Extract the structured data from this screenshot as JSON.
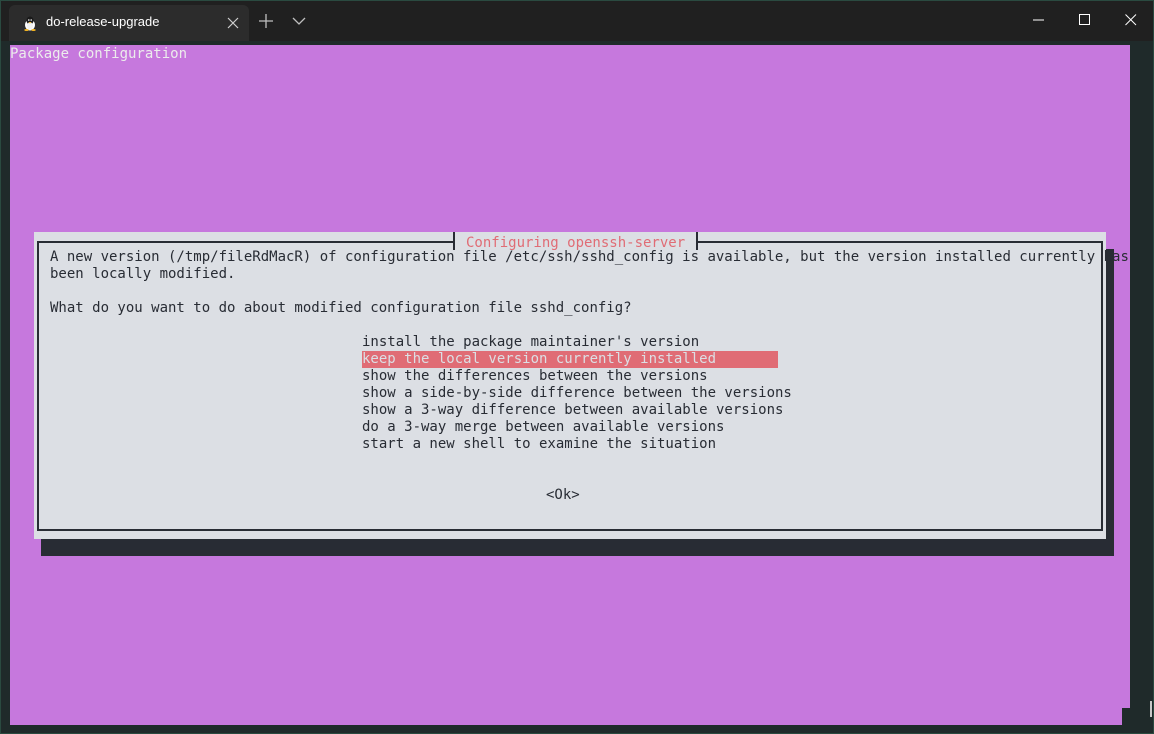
{
  "window": {
    "tab_title": "do-release-upgrade",
    "colors": {
      "terminal_bg": "#c678dd",
      "dialog_bg": "#dcdfe4",
      "accent": "#e06c75",
      "text": "#282c34"
    }
  },
  "terminal": {
    "heading": "Package configuration"
  },
  "dialog": {
    "title": "Configuring openssh-server",
    "message_line1": "A new version (/tmp/fileRdMacR) of configuration file /etc/ssh/sshd_config is available, but the version installed currently has",
    "message_line2": "been locally modified.",
    "question": "What do you want to do about modified configuration file sshd_config?",
    "options": [
      {
        "label": "install the package maintainer's version",
        "selected": false
      },
      {
        "label": "keep the local version currently installed",
        "selected": true
      },
      {
        "label": "show the differences between the versions",
        "selected": false
      },
      {
        "label": "show a side-by-side difference between the versions",
        "selected": false
      },
      {
        "label": "show a 3-way difference between available versions",
        "selected": false
      },
      {
        "label": "do a 3-way merge between available versions",
        "selected": false
      },
      {
        "label": "start a new shell to examine the situation",
        "selected": false
      }
    ],
    "ok_label": "<Ok>"
  }
}
